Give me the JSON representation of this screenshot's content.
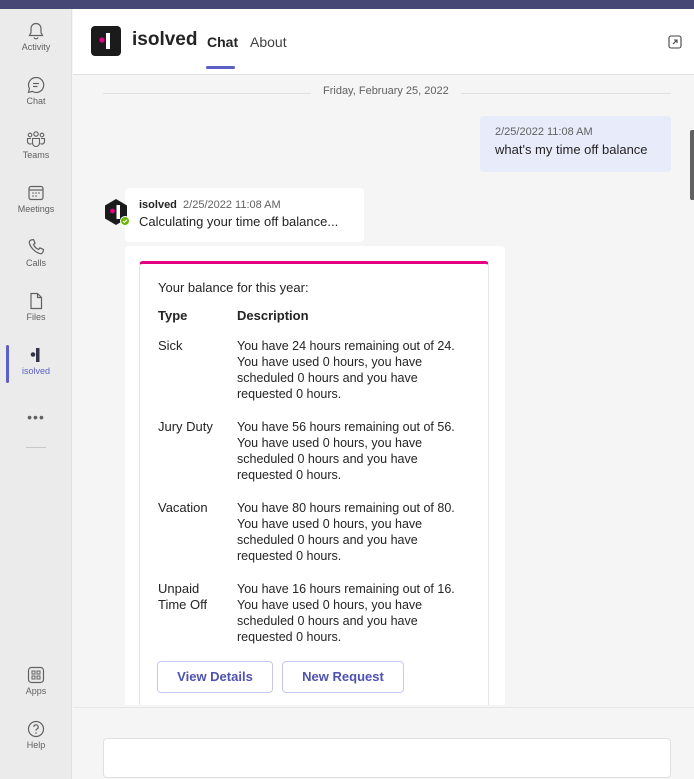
{
  "rail": {
    "items": [
      {
        "label": "Activity"
      },
      {
        "label": "Chat"
      },
      {
        "label": "Teams"
      },
      {
        "label": "Meetings"
      },
      {
        "label": "Calls"
      },
      {
        "label": "Files"
      },
      {
        "label": "isolved"
      }
    ],
    "more": "•••",
    "apps_label": "Apps",
    "help_label": "Help"
  },
  "header": {
    "app_name": "isolved",
    "tabs": [
      {
        "label": "Chat",
        "active": true
      },
      {
        "label": "About",
        "active": false
      }
    ]
  },
  "chat": {
    "date_divider": "Friday, February 25, 2022",
    "user_message": {
      "timestamp": "2/25/2022 11:08 AM",
      "text": "what's my time off balance"
    },
    "bot_message": {
      "sender": "isolved",
      "timestamp": "2/25/2022 11:08 AM",
      "text": "Calculating your time off balance..."
    },
    "card": {
      "accent_color": "#e4007f",
      "title": "Your balance for this year:",
      "columns": [
        "Type",
        "Description"
      ],
      "rows": [
        {
          "type": "Sick",
          "description": "You have 24 hours remaining out of 24. You have used 0 hours, you have scheduled 0 hours and you have requested 0 hours."
        },
        {
          "type": "Jury Duty",
          "description": "You have 56 hours remaining out of 56. You have used 0 hours, you have scheduled 0 hours and you have requested 0 hours."
        },
        {
          "type": "Vacation",
          "description": "You have 80 hours remaining out of 80. You have used 0 hours, you have scheduled 0 hours and you have requested 0 hours."
        },
        {
          "type": "Unpaid Time Off",
          "description": "You have 16 hours remaining out of 16. You have used 0 hours, you have scheduled 0 hours and you have requested 0 hours."
        }
      ],
      "buttons": [
        "View Details",
        "New Request"
      ]
    }
  },
  "colors": {
    "accent": "#5b5fc7",
    "top_bar": "#464775",
    "user_bubble": "#e8ebfa",
    "card_accent": "#e4007f"
  }
}
